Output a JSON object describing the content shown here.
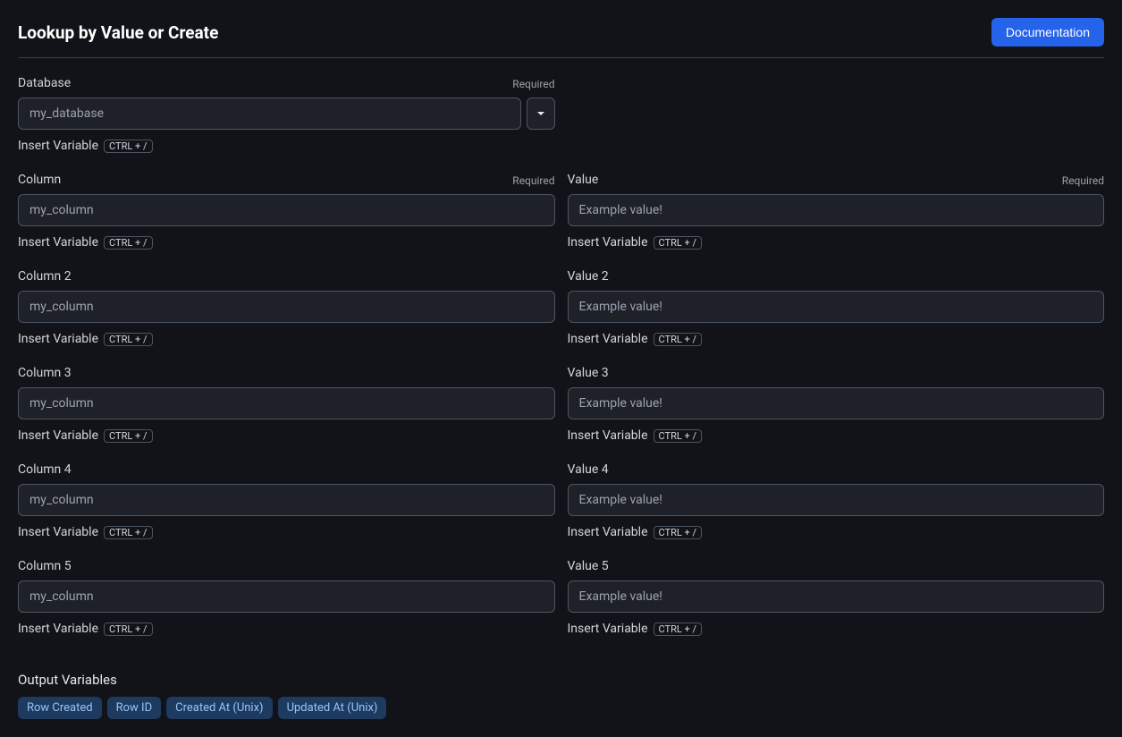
{
  "header": {
    "title": "Lookup by Value or Create",
    "doc_button": "Documentation"
  },
  "labels": {
    "required": "Required",
    "insert_variable": "Insert Variable",
    "shortcut": "CTRL + /",
    "output_variables": "Output Variables"
  },
  "database": {
    "label": "Database",
    "placeholder": "my_database"
  },
  "pairs": [
    {
      "col_label": "Column",
      "col_placeholder": "my_column",
      "col_required": true,
      "val_label": "Value",
      "val_placeholder": "Example value!",
      "val_required": true
    },
    {
      "col_label": "Column 2",
      "col_placeholder": "my_column",
      "col_required": false,
      "val_label": "Value 2",
      "val_placeholder": "Example value!",
      "val_required": false
    },
    {
      "col_label": "Column 3",
      "col_placeholder": "my_column",
      "col_required": false,
      "val_label": "Value 3",
      "val_placeholder": "Example value!",
      "val_required": false
    },
    {
      "col_label": "Column 4",
      "col_placeholder": "my_column",
      "col_required": false,
      "val_label": "Value 4",
      "val_placeholder": "Example value!",
      "val_required": false
    },
    {
      "col_label": "Column 5",
      "col_placeholder": "my_column",
      "col_required": false,
      "val_label": "Value 5",
      "val_placeholder": "Example value!",
      "val_required": false
    }
  ],
  "output_vars": [
    "Row Created",
    "Row ID",
    "Created At (Unix)",
    "Updated At (Unix)"
  ]
}
